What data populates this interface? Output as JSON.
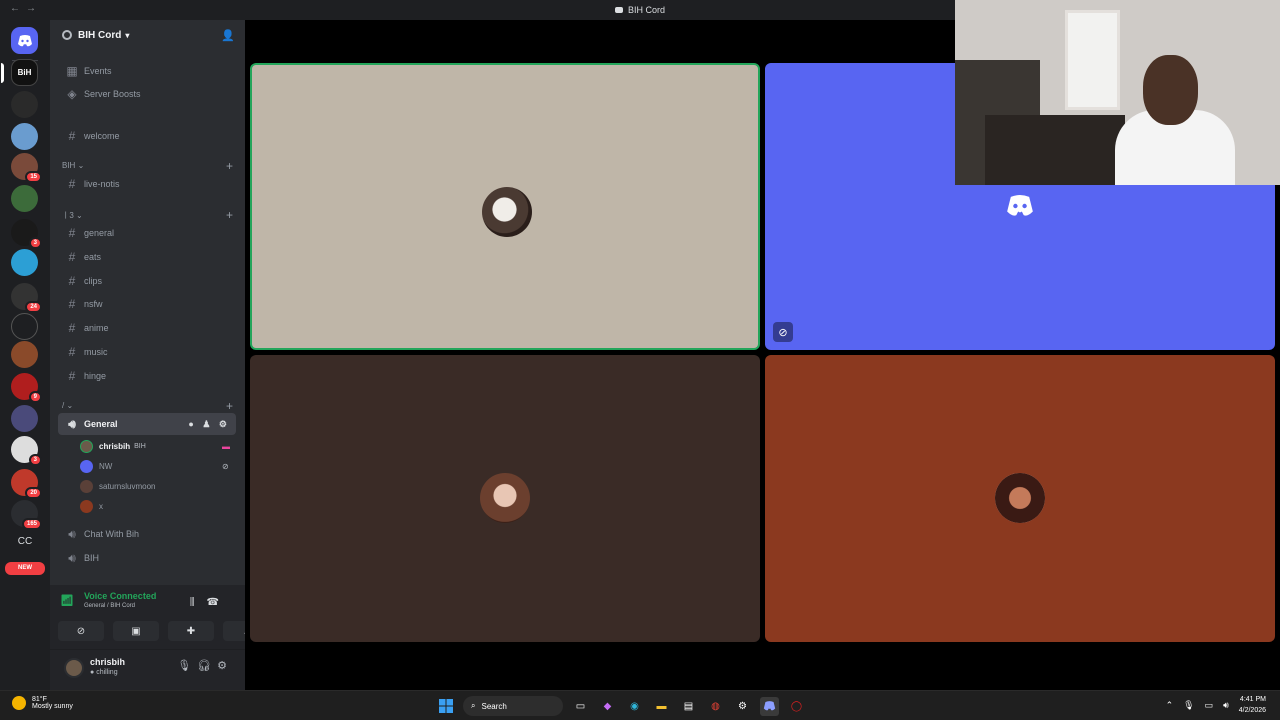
{
  "window": {
    "title": "BIH Cord"
  },
  "server": {
    "name": "BIH Cord"
  },
  "sidebar": {
    "top_items": [
      {
        "label": "Events"
      },
      {
        "label": "Server Boosts"
      }
    ],
    "channels": {
      "welcome": "welcome",
      "cat_bih": "BIH",
      "live_notis": "live-notis",
      "cat_2": "ㅣ3",
      "general": "general",
      "eats": "eats",
      "clips": "clips",
      "nsfw": "nsfw",
      "anime": "anime",
      "music": "music",
      "hinge": "hinge",
      "cat_3": "/",
      "voice_general": "General",
      "voice_chat_with_bih": "Chat With Bih",
      "voice_bih": "BIH"
    },
    "voice_users": [
      {
        "name": "chrisbih",
        "role": "BIH"
      },
      {
        "name": "NW",
        "role": ""
      },
      {
        "name": "saturnsluvmoon",
        "role": ""
      },
      {
        "name": "x",
        "role": ""
      }
    ]
  },
  "server_rail": {
    "badges": [
      "15",
      "3",
      "24",
      "9",
      "3",
      "20",
      "165"
    ],
    "text_server": "CC",
    "new_label": "NEW"
  },
  "voice_panel": {
    "title": "Voice Connected",
    "subtitle": "General / BIH Cord"
  },
  "user_panel": {
    "name": "chrisbih",
    "status": "chilling"
  },
  "taskbar": {
    "temp": "81°F",
    "weather": "Mostly sunny",
    "search": "Search",
    "time": "4:41 PM",
    "date": "4/2/2026"
  },
  "colors": {
    "discord_blurple": "#5865f2",
    "tile1_bg": "#bfb6a8",
    "tile3_bg": "#3a2b26",
    "tile4_bg": "#8b391f",
    "voice_green": "#23a55a",
    "speaking_border": "#23a55a"
  }
}
